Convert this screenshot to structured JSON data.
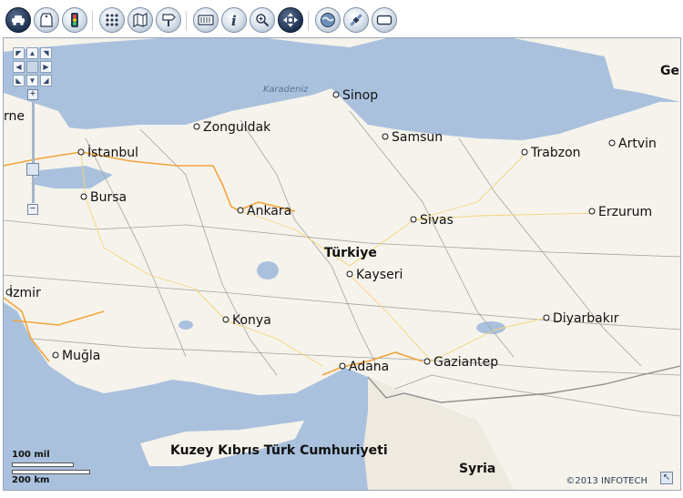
{
  "toolbar": {
    "icons": [
      "car-icon",
      "tag-icon",
      "traffic-light-icon",
      "grid-icon",
      "map-icon",
      "signpost-icon",
      "keyboard-icon",
      "info-icon",
      "zoom-search-icon",
      "pan-arrows-icon",
      "globe-icon",
      "satellite-icon",
      "rectangle-icon"
    ]
  },
  "map": {
    "sea_labels": {
      "karadeniz": "Karadeniz"
    },
    "country_labels": {
      "turkiye": "Türkiye",
      "cyprus": "Kuzey Kıbrıs Türk Cumhuriyeti",
      "syria": "Syria",
      "georgia_partial": "Ge"
    },
    "cities": {
      "sinop": "Sinop",
      "zonguldak": "Zonguldak",
      "samsun": "Samsun",
      "trabzon": "Trabzon",
      "artvin": "Artvin",
      "istanbul": "İstanbul",
      "edirne_partial": "rne",
      "bursa": "Bursa",
      "ankara": "Ankara",
      "sivas": "Sivas",
      "erzurum": "Erzurum",
      "kayseri": "Kayseri",
      "izmir": "İzmir",
      "konya": "Konya",
      "diyarbakir": "Diyarbakır",
      "mugla": "Muğla",
      "adana": "Adana",
      "gaziantep": "Gaziantep"
    },
    "scale": {
      "miles": "100 mil",
      "km": "200 km"
    },
    "copyright": "©2013 INFOTECH",
    "colors": {
      "sea": "#a9c1dd",
      "land": "#f6f3ec",
      "highway": "#f2a43c",
      "border": "#8f8f8f"
    }
  }
}
